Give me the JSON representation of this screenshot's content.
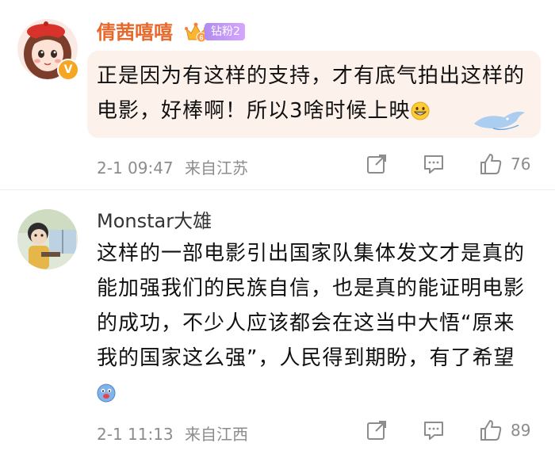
{
  "comments": [
    {
      "username": "倩茜嘻嘻",
      "badge_label": "钻粉2",
      "badge_level": "6",
      "text": "正是因为有这样的支持，才有底气拍出这样的电影，好棒啊！所以3啥时候上映",
      "emoji": "grin-icon",
      "date": "2-1 09:47",
      "location": "来自江苏",
      "likes": "76",
      "verified": true,
      "username_color": "#e8682c"
    },
    {
      "username": "Monstar大雄",
      "text": "这样的一部电影引出国家队集体发文才是真的能加强我们的民族自信，也是真的能证明电影的成功，不少人应该都会在这当中大悟“原来我的国家这么强”，人民得到期盼，有了希望",
      "emoji": "blue-face-icon",
      "date": "2-1 11:13",
      "location": "来自江西",
      "likes": "89"
    }
  ],
  "icons": [
    "share-icon",
    "comment-icon",
    "like-icon"
  ]
}
